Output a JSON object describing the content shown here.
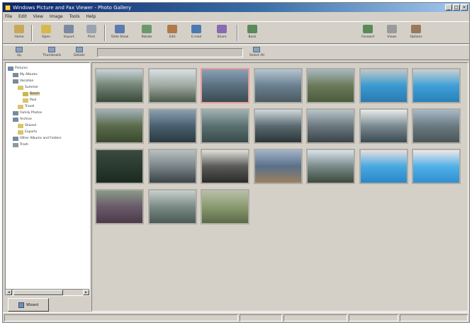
{
  "window": {
    "title": "Windows Picture and Fax Viewer - Photo Gallery",
    "controls": [
      "_",
      "□",
      "×"
    ]
  },
  "menu": [
    "File",
    "Edit",
    "View",
    "Image",
    "Tools",
    "Help"
  ],
  "toolbar": {
    "buttons": [
      {
        "label": "Home",
        "icon": "home-icon",
        "color": "#c9a85a"
      },
      {
        "label": "Open",
        "icon": "folder-icon",
        "color": "#d8b84a"
      },
      {
        "label": "Import",
        "icon": "camera-icon",
        "color": "#7a8aa0"
      },
      {
        "label": "Print",
        "icon": "printer-icon",
        "color": "#9aa4b0"
      },
      {
        "label": "Slide Show",
        "icon": "slideshow-icon",
        "color": "#5a7ab0"
      },
      {
        "label": "Rotate",
        "icon": "rotate-icon",
        "color": "#6a9a6a"
      },
      {
        "label": "Edit",
        "icon": "edit-icon",
        "color": "#b07a4a"
      },
      {
        "label": "E-mail",
        "icon": "email-icon",
        "color": "#4a7ab0"
      },
      {
        "label": "Share",
        "icon": "share-icon",
        "color": "#8a6ab0"
      },
      {
        "label": "Back",
        "icon": "back-icon",
        "color": "#5a8a5a"
      },
      {
        "label": "Forward",
        "icon": "forward-icon",
        "color": "#5a8a5a"
      },
      {
        "label": "Views",
        "icon": "views-icon",
        "color": "#9a9a9a"
      },
      {
        "label": "Options",
        "icon": "options-icon",
        "color": "#9a7a5a"
      }
    ]
  },
  "toolbar2": {
    "buttons": [
      "Up",
      "Thumbnails",
      "Details"
    ],
    "path": "",
    "right_button": "Select All"
  },
  "tree": {
    "items": [
      "Pictures",
      "My Albums",
      "Vacation",
      "Summer",
      "Beach",
      "Pool",
      "Travel",
      "Family Photos",
      "Archive",
      "Shared",
      "Exports",
      "Other Albums and Folders",
      "Trash"
    ]
  },
  "wizard_button": "Wizard",
  "thumbnails": [
    {
      "gradient": "linear-gradient(180deg,#c8d4dc 0%,#7a8a7a 45%,#3a4a3a 100%)"
    },
    {
      "gradient": "linear-gradient(180deg,#d8e0e4 0%,#a0a8a0 50%,#4a5a4a 100%)"
    },
    {
      "gradient": "linear-gradient(180deg,#8aa0b4 0%,#5a7080 50%,#3a4a50 100%)",
      "selected": true
    },
    {
      "gradient": "linear-gradient(180deg,#b4c4d0 0%,#6a8090 50%,#4a5a60 100%)"
    },
    {
      "gradient": "linear-gradient(180deg,#a8b8c0 0%,#6a7a5a 50%,#4a5a3a 100%)"
    },
    {
      "gradient": "linear-gradient(180deg,#c0c8c8 0%,#3a9ad0 50%,#2a7ab0 100%)"
    },
    {
      "gradient": "linear-gradient(180deg,#c8d0d0 0%,#40a0d8 50%,#2a80b8 100%)"
    },
    {
      "gradient": "linear-gradient(180deg,#a0b0b8 0%,#5a6a4a 50%,#3a4a30 100%)"
    },
    {
      "gradient": "linear-gradient(180deg,#8aa0b0 0%,#4a6070 50%,#2a3a40 100%)"
    },
    {
      "gradient": "linear-gradient(180deg,#a0b0b4 0%,#5a7070 50%,#3a4a4a 100%)"
    },
    {
      "gradient": "linear-gradient(180deg,#d0d8dc 0%,#5a6a70 50%,#2a3438 100%)"
    },
    {
      "gradient": "linear-gradient(180deg,#b8c4c8 0%,#6a7880 50%,#3a4448 100%)"
    },
    {
      "gradient": "linear-gradient(180deg,#e8ecec 0%,#7a8a90 50%,#3a4a50 100%)"
    },
    {
      "gradient": "linear-gradient(180deg,#a8b8c8 0%,#6a7a80 50%,#4a5458 100%)"
    },
    {
      "gradient": "linear-gradient(180deg,#3a4a40 0%,#2a3a30 50%,#1a2a20 100%)"
    },
    {
      "gradient": "linear-gradient(180deg,#b8c0c0 0%,#7a8488 50%,#3a4448 100%)"
    },
    {
      "gradient": "linear-gradient(180deg,#e0e0dc 0%,#5a5a58 50%,#2a2a28 100%)"
    },
    {
      "gradient": "linear-gradient(180deg,#a0b4c8 0%,#5a7088 50%,#9a8060 100%)"
    },
    {
      "gradient": "linear-gradient(180deg,#d8e4ec 0%,#7a8a8a 50%,#3a4a3a 100%)"
    },
    {
      "gradient": "linear-gradient(180deg,#e8e0e0 0%,#48a8e0 50%,#2a88c8 100%)"
    },
    {
      "gradient": "linear-gradient(180deg,#f0e8e8 0%,#50b0e8 50%,#3090d0 100%)"
    },
    {
      "gradient": "linear-gradient(180deg,#8a9a88 0%,#6a5a6a 50%,#4a3a4a 100%)"
    },
    {
      "gradient": "linear-gradient(180deg,#c8d0cc 0%,#7a8a84 50%,#4a5a54 100%)"
    },
    {
      "gradient": "linear-gradient(180deg,#b8c0a8 0%,#8a9a70 50%,#5a6a48 100%)"
    }
  ],
  "statusbar": {
    "panels": [
      "",
      "",
      "",
      "",
      ""
    ]
  }
}
